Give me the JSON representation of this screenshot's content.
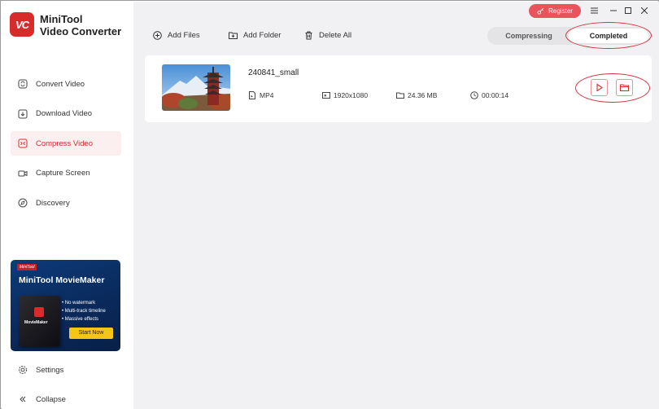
{
  "app": {
    "title_line1": "MiniTool",
    "title_line2": "Video Converter",
    "logo_text": "VC"
  },
  "sidebar": {
    "items": [
      {
        "label": "Convert Video",
        "icon": "convert-icon",
        "active": false
      },
      {
        "label": "Download Video",
        "icon": "download-icon",
        "active": false
      },
      {
        "label": "Compress Video",
        "icon": "compress-icon",
        "active": true
      },
      {
        "label": "Capture Screen",
        "icon": "camera-icon",
        "active": false
      },
      {
        "label": "Discovery",
        "icon": "compass-icon",
        "active": false
      }
    ],
    "settings_label": "Settings",
    "collapse_label": "Collapse"
  },
  "promo": {
    "brand": "MiniTool",
    "title": "MiniTool MovieMaker",
    "box_label": "MovieMaker",
    "features": [
      "• No watermark",
      "• Multi-track timeline",
      "• Massive effects"
    ],
    "button_label": "Start Now"
  },
  "header": {
    "register_label": "Register",
    "toolbar": {
      "add_files": "Add Files",
      "add_folder": "Add Folder",
      "delete_all": "Delete All"
    },
    "tabs": [
      {
        "label": "Compressing",
        "active": false
      },
      {
        "label": "Completed",
        "active": true
      }
    ]
  },
  "file": {
    "name": "240841_small",
    "format": "MP4",
    "resolution": "1920x1080",
    "size": "24.36 MB",
    "duration": "00:00:14"
  },
  "colors": {
    "accent": "#d62c2c",
    "register": "#e9535b",
    "background": "#f1f1f3"
  }
}
